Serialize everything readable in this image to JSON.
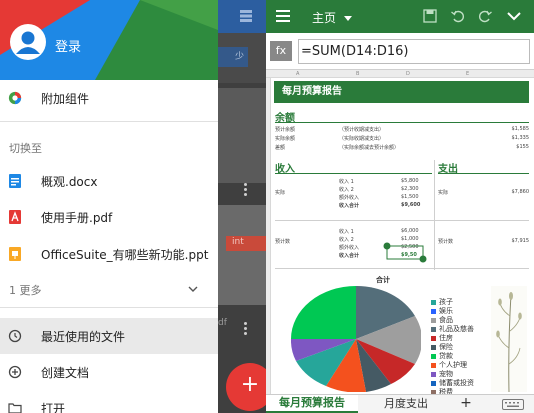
{
  "drawer": {
    "login_label": "登录",
    "addons_label": "附加组件",
    "switch_heading": "切换至",
    "files": [
      {
        "name": "概观.docx",
        "icon": "document-icon",
        "color": "#1E88E5"
      },
      {
        "name": "使用手册.pdf",
        "icon": "pdf-icon",
        "color": "#E53935"
      },
      {
        "name": "OfficeSuite_有哪些新功能.ppt",
        "icon": "presentation-icon",
        "color": "#F9A825"
      }
    ],
    "more_label": "1 更多",
    "recent_label": "最近使用的文件",
    "create_label": "创建文档",
    "open_label": "打开"
  },
  "mid": {
    "bubble_text": "少",
    "red_tag_text": "int",
    "side_text": "df",
    "fab_label": "+"
  },
  "app": {
    "toolbar": {
      "title": "主页"
    },
    "formula": {
      "fx_label": "fx",
      "value": "=SUM(D14:D16)"
    },
    "columns": [
      "A",
      "B",
      "C",
      "D",
      "E"
    ],
    "sheet": {
      "title": "每月预算报告",
      "balance_heading": "余额",
      "balance_rows": [
        {
          "label": "预计余额",
          "desc": "（预计收期减支出）",
          "value": "$1,585"
        },
        {
          "label": "实际余额",
          "desc": "（实际收期减支出）",
          "value": "$1,335"
        },
        {
          "label": "差额",
          "desc": "（实际余额减去预计余额）",
          "value": "$155"
        }
      ],
      "income_heading": "收入",
      "expense_heading": "支出",
      "actual_label": "实际",
      "actual_income": [
        {
          "label": "收入 1",
          "value": "$5,800"
        },
        {
          "label": "收入 2",
          "value": "$2,300"
        },
        {
          "label": "额外收入",
          "value": "$1,500"
        },
        {
          "label": "收入合计",
          "value": "$9,600"
        }
      ],
      "actual_expense": "$7,860",
      "projected_label": "预计数",
      "projected_income": [
        {
          "label": "收入 1",
          "value": "$6,000"
        },
        {
          "label": "收入 2",
          "value": "$1,000"
        },
        {
          "label": "额外收入",
          "value": "$2,500"
        },
        {
          "label": "收入合计",
          "value": "$9,50"
        }
      ],
      "projected_expense": "$7,915",
      "chart_title": "合计"
    },
    "legend": [
      {
        "label": "孩子",
        "color": "#26A69A"
      },
      {
        "label": "娱乐",
        "color": "#2962FF"
      },
      {
        "label": "食品",
        "color": "#9E9E9E"
      },
      {
        "label": "礼品及慈善",
        "color": "#546E7A"
      },
      {
        "label": "住房",
        "color": "#C62828"
      },
      {
        "label": "保险",
        "color": "#455A64"
      },
      {
        "label": "贷款",
        "color": "#00C853"
      },
      {
        "label": "个人护理",
        "color": "#F4511E"
      },
      {
        "label": "宠物",
        "color": "#7E57C2"
      },
      {
        "label": "储蓄或投资",
        "color": "#1565C0"
      },
      {
        "label": "税费",
        "color": "#8D6E63"
      }
    ],
    "tabs": {
      "active": "每月预算报告",
      "second": "月度支出",
      "add": "+"
    }
  }
}
